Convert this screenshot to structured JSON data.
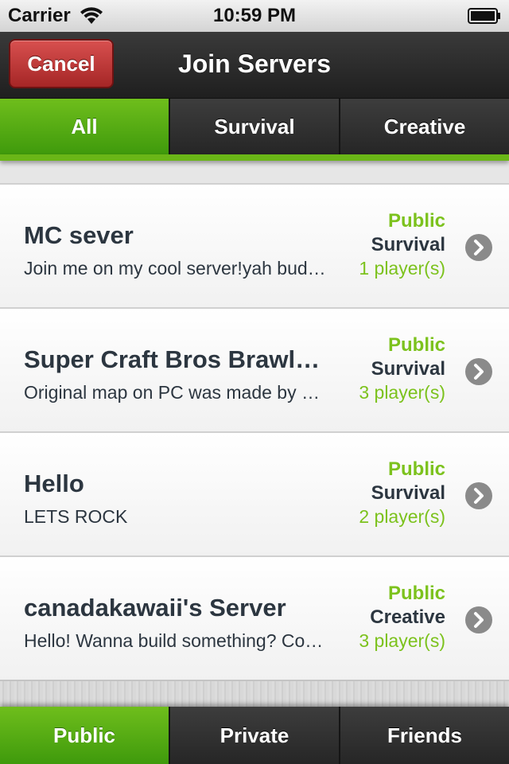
{
  "status_bar": {
    "carrier": "Carrier",
    "time": "10:59 PM"
  },
  "nav": {
    "cancel_label": "Cancel",
    "title": "Join Servers"
  },
  "filter_tabs": [
    {
      "label": "All",
      "active": true
    },
    {
      "label": "Survival",
      "active": false
    },
    {
      "label": "Creative",
      "active": false
    }
  ],
  "servers": [
    {
      "name": "MC sever",
      "description": "Join me on my cool server!yah buddy!",
      "access": "Public",
      "mode": "Survival",
      "players": "1 player(s)"
    },
    {
      "name": "Super Craft Bros Brawl Tutorial",
      "description": "Original map on PC was made by Mojang",
      "access": "Public",
      "mode": "Survival",
      "players": "3 player(s)"
    },
    {
      "name": "Hello",
      "description": "LETS ROCK",
      "access": "Public",
      "mode": "Survival",
      "players": "2 player(s)"
    },
    {
      "name": "canadakawaii's Server",
      "description": "Hello! Wanna build something? Come in",
      "access": "Public",
      "mode": "Creative",
      "players": "3 player(s)"
    }
  ],
  "bottom_tabs": [
    {
      "label": "Public",
      "active": true
    },
    {
      "label": "Private",
      "active": false
    },
    {
      "label": "Friends",
      "active": false
    }
  ],
  "colors": {
    "accent_green": "#7cc21d",
    "cancel_red": "#c23a3a",
    "text_dark": "#2c3640"
  },
  "icons": [
    "wifi-icon",
    "battery-icon",
    "chevron-right-icon"
  ]
}
